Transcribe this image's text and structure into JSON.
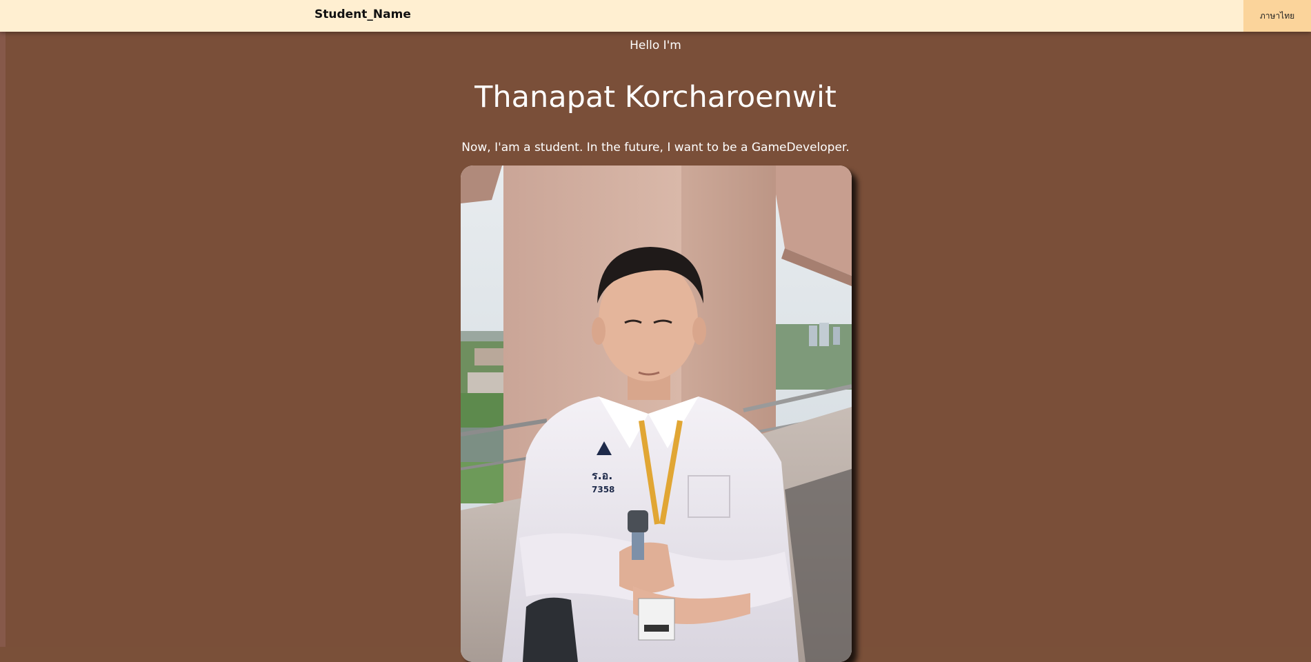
{
  "navbar": {
    "brand": "Student_Name",
    "language_button": "ภาษาไทย"
  },
  "hero": {
    "greeting": "Hello I'm",
    "name": "Thanapat Korcharoenwit",
    "tagline": "Now, I'am a student. In the future, I want to be a GameDeveloper."
  },
  "photo": {
    "badge_text": "7358",
    "badge_logo_text": "ร.อ."
  },
  "colors": {
    "page_background": "#7a4f39",
    "navbar_background": "#ffefd1",
    "language_button_background": "#fbd49b",
    "text_light": "#ffffff"
  }
}
